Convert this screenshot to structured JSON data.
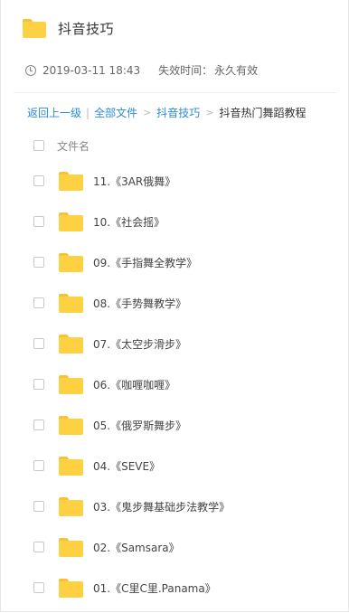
{
  "header": {
    "title": "抖音技巧",
    "icon": "folder-icon"
  },
  "meta": {
    "date": "2019-03-11 18:43",
    "expire_label": "失效时间：",
    "expire_value": "永久有效"
  },
  "breadcrumb": {
    "back": "返回上一级",
    "separator": "|",
    "all_files": "全部文件",
    "folder": "抖音技巧",
    "arrow": ">",
    "current": "抖音热门舞蹈教程"
  },
  "list": {
    "column_header": "文件名",
    "items": [
      {
        "name": "11.《3AR俄舞》"
      },
      {
        "name": "10.《社会摇》"
      },
      {
        "name": "09.《手指舞全教学》"
      },
      {
        "name": "08.《手势舞教学》"
      },
      {
        "name": "07.《太空步滑步》"
      },
      {
        "name": "06.《咖喱咖喱》"
      },
      {
        "name": "05.《俄罗斯舞步》"
      },
      {
        "name": "04.《SEVE》"
      },
      {
        "name": "03.《鬼步舞基础步法教学》"
      },
      {
        "name": "02.《Samsara》"
      },
      {
        "name": "01.《C里C里.Panama》"
      }
    ]
  },
  "colors": {
    "link": "#2d8ad8",
    "folder": "#fdd142"
  }
}
